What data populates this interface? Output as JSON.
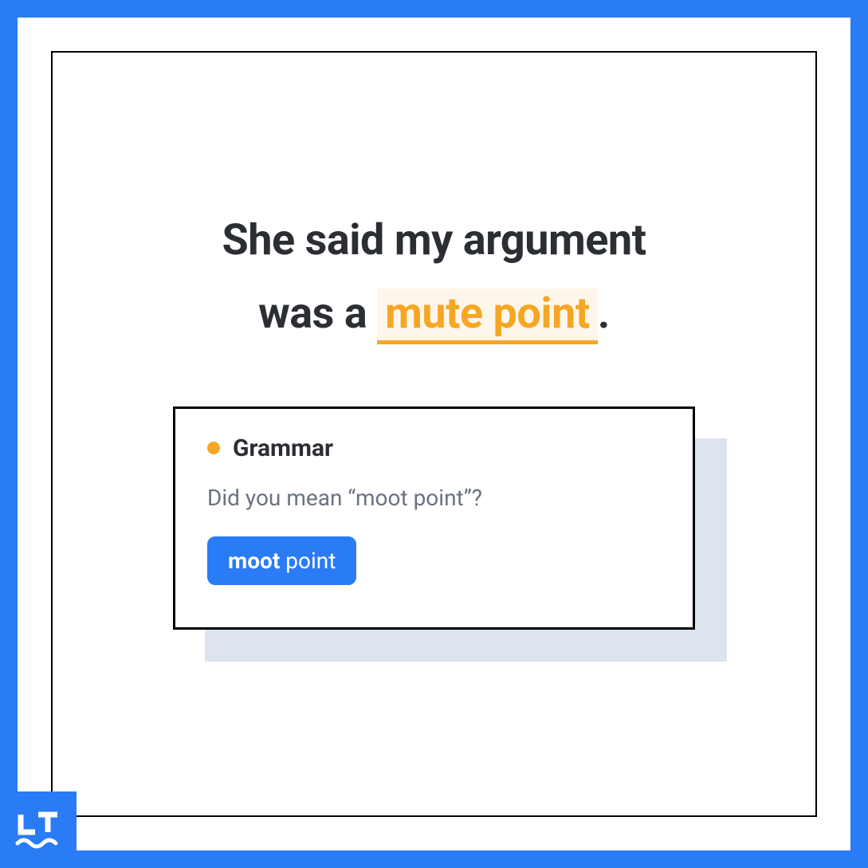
{
  "sentence": {
    "line1": "She said my argument",
    "line2_prefix": "was a ",
    "highlighted": "mute point",
    "line2_suffix": "."
  },
  "tooltip": {
    "category": "Grammar",
    "message": "Did you mean “moot point”?",
    "suggestion_bold": "moot",
    "suggestion_rest": " point"
  },
  "colors": {
    "accent_blue": "#2a7bf6",
    "highlight_orange": "#f5a623",
    "highlight_bg": "#fff6eb",
    "shadow": "#dde3ef"
  },
  "logo": {
    "name": "LT"
  }
}
